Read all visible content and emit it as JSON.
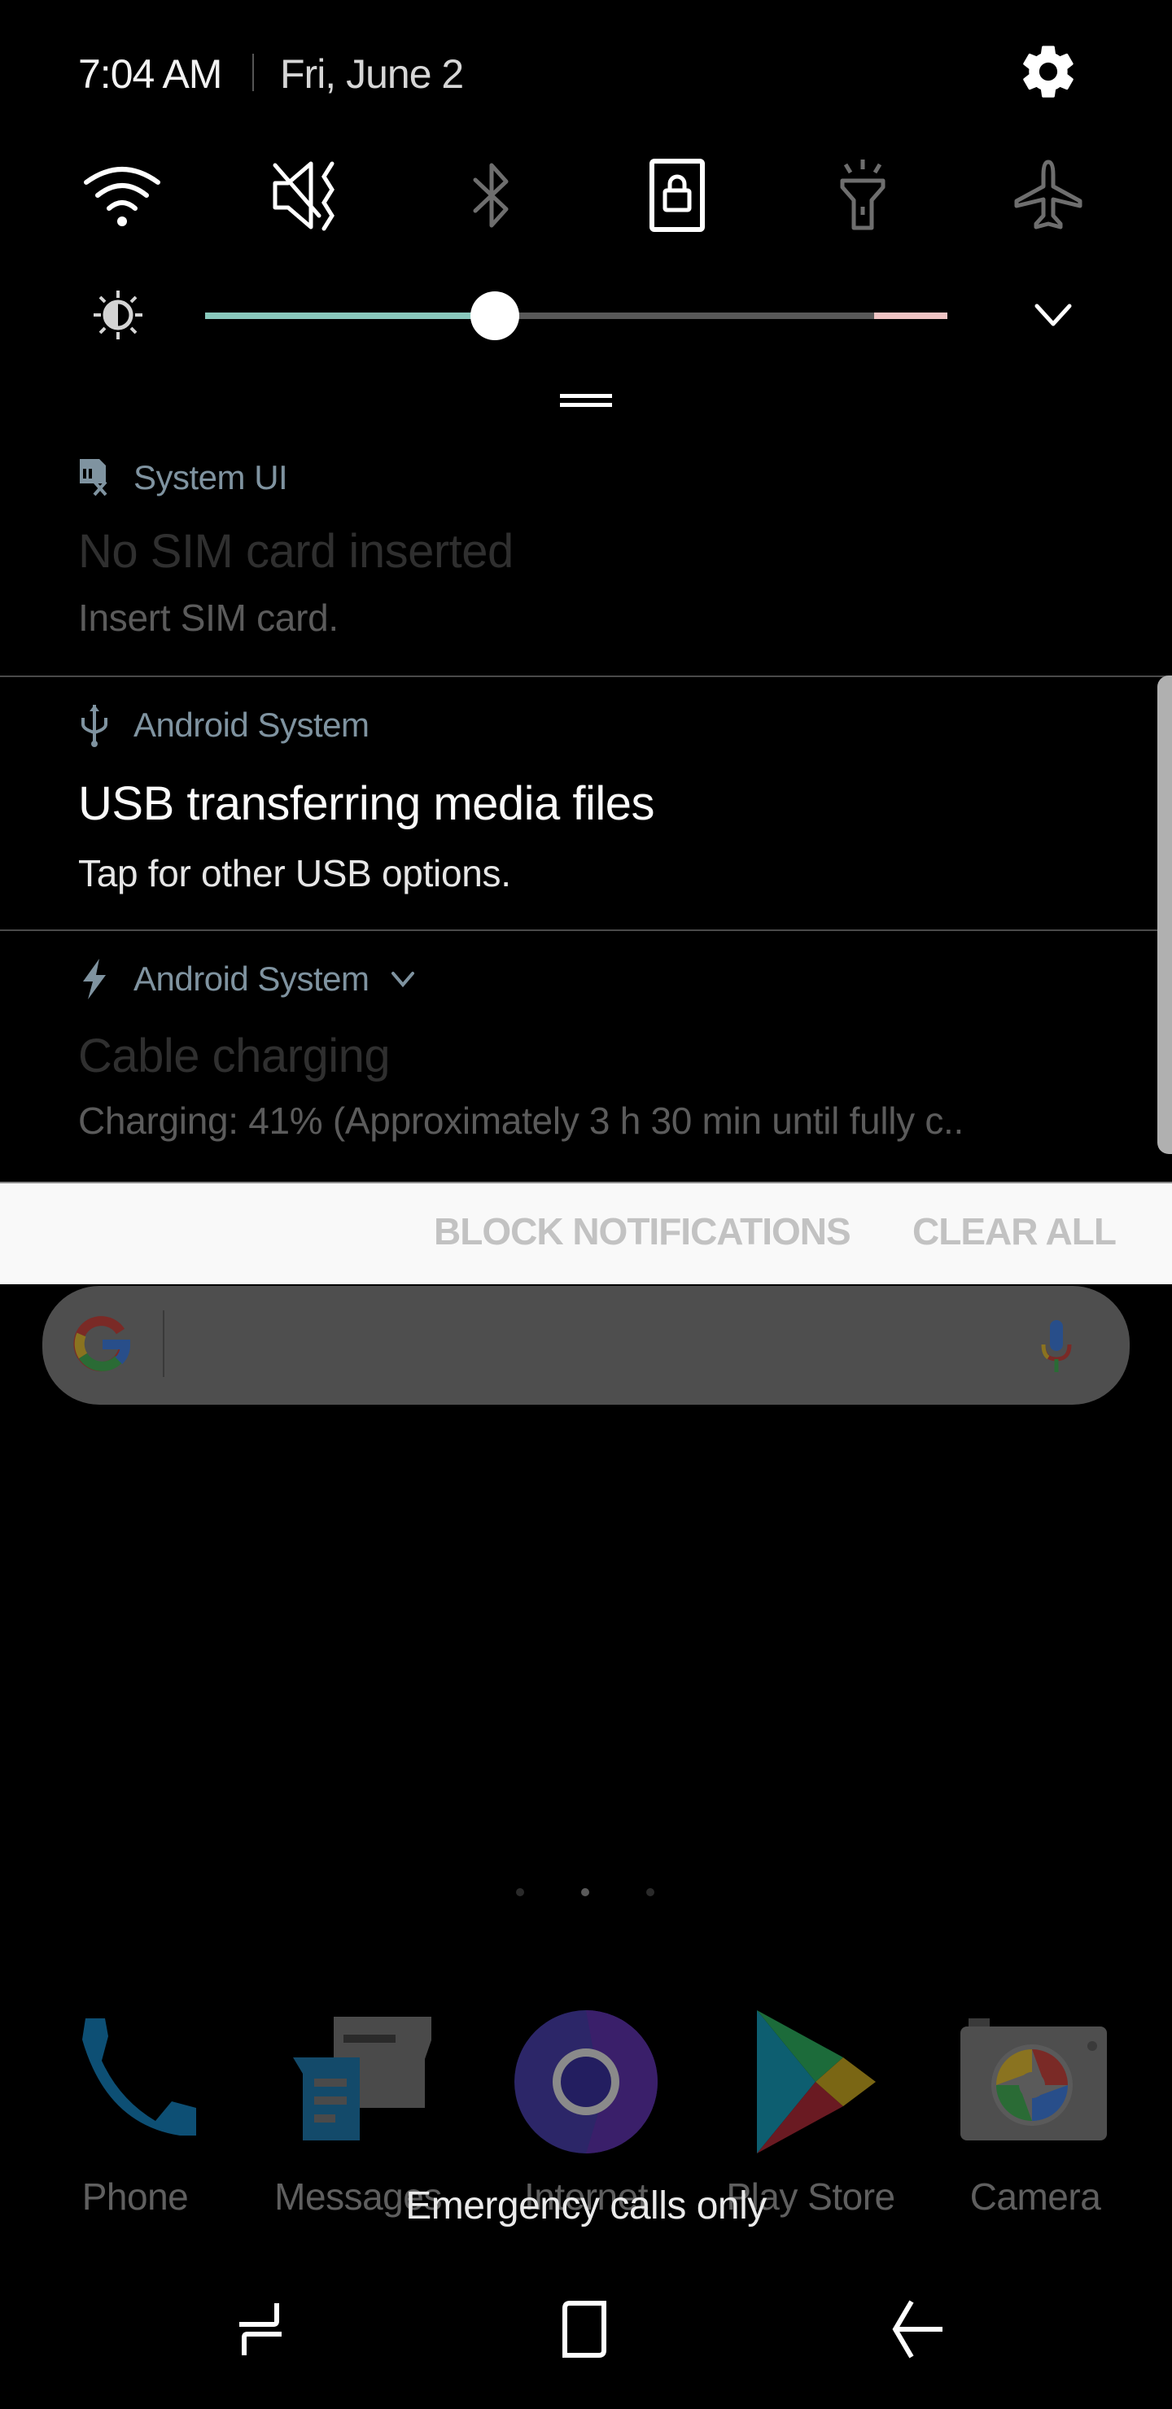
{
  "header": {
    "time": "7:04 AM",
    "date": "Fri, June 2",
    "settings_icon": "gear-icon"
  },
  "quick_toggles": [
    {
      "name": "wifi",
      "icon": "wifi-icon",
      "state": "on"
    },
    {
      "name": "sound",
      "icon": "mute-vibrate-icon",
      "state": "on"
    },
    {
      "name": "bluetooth",
      "icon": "bluetooth-icon",
      "state": "off"
    },
    {
      "name": "screen-rotation-lock",
      "icon": "portrait-lock-icon",
      "state": "on"
    },
    {
      "name": "flashlight",
      "icon": "flashlight-icon",
      "state": "off"
    },
    {
      "name": "airplane-mode",
      "icon": "airplane-icon",
      "state": "off"
    }
  ],
  "brightness": {
    "level": 0.39,
    "icon": "brightness-icon",
    "colors": {
      "fill": "#89c9bd",
      "track": "#585858",
      "warn": "#f0c4c4"
    }
  },
  "notifications": [
    {
      "app": "System UI",
      "icon": "sim-card-x-icon",
      "title": "No SIM card inserted",
      "text": "Insert SIM card.",
      "dimmed": true
    },
    {
      "app": "Android System",
      "icon": "usb-icon",
      "title": "USB transferring media files",
      "text": "Tap for other USB options.",
      "dimmed": false
    },
    {
      "app": "Android System",
      "icon": "lightning-bolt-icon",
      "title": "Cable charging",
      "text": "Charging: 41% (Approximately 3 h 30 min until fully c..",
      "dimmed": true,
      "expandable": true
    }
  ],
  "actions": {
    "block_notifications": "BLOCK NOTIFICATIONS",
    "clear_all": "CLEAR ALL"
  },
  "search": {
    "placeholder": "",
    "logo": "google-g-icon",
    "voice": "microphone-icon"
  },
  "home": {
    "pages": 3,
    "active_page": 2
  },
  "dock": [
    {
      "label": "Phone",
      "icon": "phone-icon"
    },
    {
      "label": "Messages",
      "icon": "messages-icon"
    },
    {
      "label": "Internet",
      "icon": "internet-icon"
    },
    {
      "label": "Play Store",
      "icon": "play-store-icon"
    },
    {
      "label": "Camera",
      "icon": "camera-icon"
    }
  ],
  "status_overlay": "Emergency calls only",
  "navbar": {
    "recents": "recents-icon",
    "home": "home-icon",
    "back": "back-icon"
  }
}
